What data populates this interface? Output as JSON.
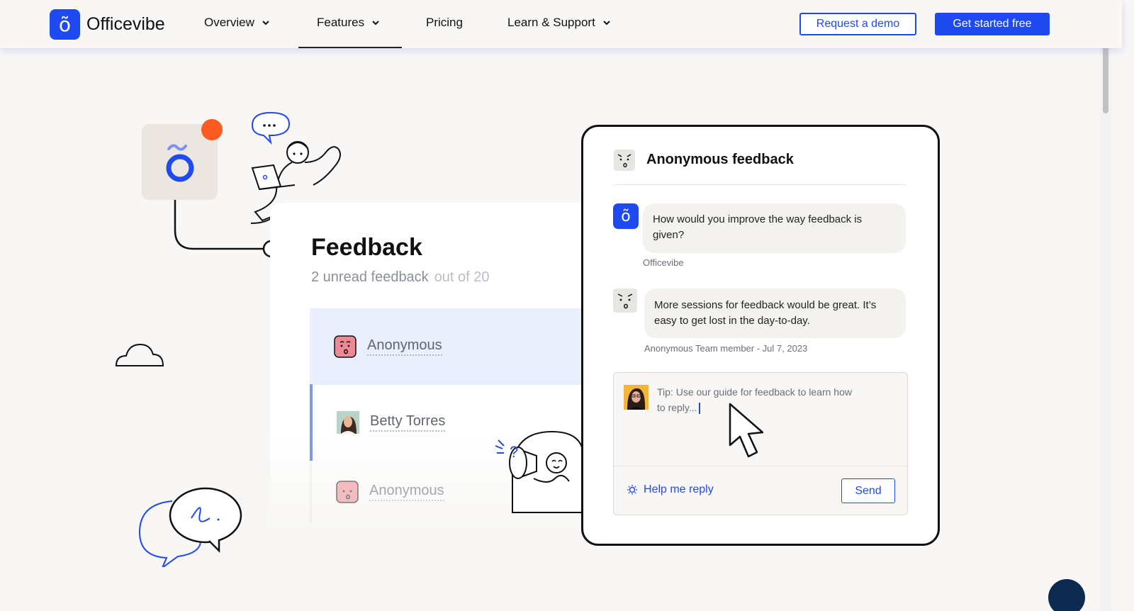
{
  "brand": {
    "name": "Officevibe",
    "mark": "õ"
  },
  "nav": {
    "items": [
      {
        "label": "Overview",
        "has_dropdown": true
      },
      {
        "label": "Features",
        "has_dropdown": true,
        "active": true
      },
      {
        "label": "Pricing",
        "has_dropdown": false
      },
      {
        "label": "Learn & Support",
        "has_dropdown": true
      }
    ],
    "request_demo": "Request a demo",
    "get_started": "Get started free"
  },
  "feedback_panel": {
    "title": "Feedback",
    "unread": "2 unread feedback",
    "total": "out of 20",
    "rows": [
      {
        "name": "Anonymous",
        "avatar": "anonymous-face-icon",
        "selected": true
      },
      {
        "name": "Betty Torres",
        "avatar": "user-photo"
      },
      {
        "name": "Anonymous",
        "avatar": "anonymous-face-icon"
      }
    ]
  },
  "chat": {
    "title": "Anonymous feedback",
    "messages": [
      {
        "text": "How would you improve the way feedback is given?",
        "author": "Officevibe"
      },
      {
        "text": "More sessions for feedback would be great. It’s easy to get lost in the day-to-day.",
        "author": "Anonymous Team member - Jul 7, 2023"
      }
    ],
    "reply_placeholder": "Tip: Use our guide for feedback to learn how to reply...",
    "help_label": "Help me reply",
    "send_label": "Send"
  },
  "colors": {
    "brand_blue": "#1f4af0",
    "notification": "#fb5a20",
    "anon_pink": "#ec8a94"
  }
}
